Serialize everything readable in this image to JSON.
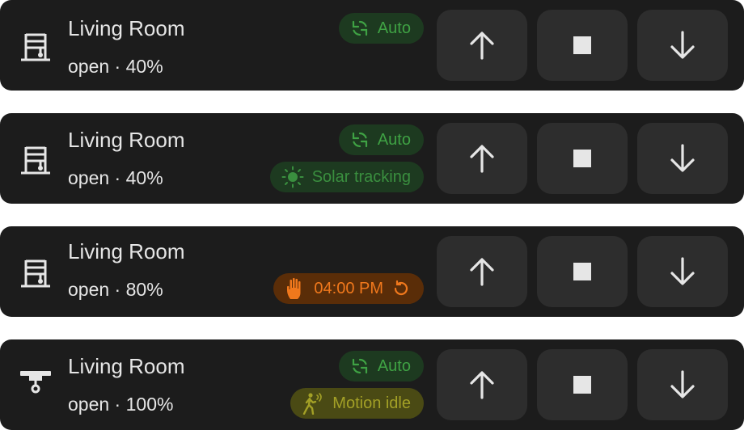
{
  "cards": [
    {
      "name": "Living Room",
      "status": "open · 40%",
      "chips": {
        "auto": "Auto"
      }
    },
    {
      "name": "Living Room",
      "status": "open · 40%",
      "chips": {
        "auto": "Auto",
        "solar": "Solar tracking"
      }
    },
    {
      "name": "Living Room",
      "status": "open · 80%",
      "chips": {
        "manual_time": "04:00 PM"
      }
    },
    {
      "name": "Living Room",
      "status": "open · 100%",
      "chips": {
        "auto": "Auto",
        "motion": "Motion idle"
      }
    }
  ],
  "icons": {
    "card1": "window-shutter-icon",
    "card2": "window-shutter-icon",
    "card3": "window-shutter-icon",
    "card4": "curtain-rail-icon",
    "auto": "sync-icon",
    "solar": "sun-icon",
    "manual": "hand-icon",
    "reset": "reset-icon",
    "motion": "walking-person-icon",
    "open": "arrow-up-icon",
    "stop": "stop-icon",
    "close": "arrow-down-icon"
  },
  "colors": {
    "card_background": "#1c1c1c",
    "button_background": "#2d2d2d",
    "auto_green": "#3fa244",
    "manual_orange": "#f0781c",
    "motion_olive": "#a3a026"
  }
}
